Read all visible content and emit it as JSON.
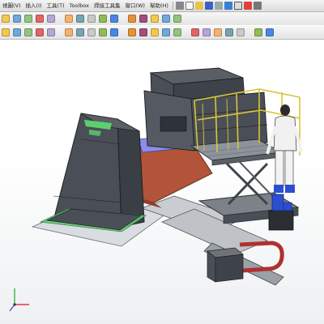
{
  "menubar": {
    "items": [
      {
        "id": "view",
        "label": "視圖(V)"
      },
      {
        "id": "insert",
        "label": "插入(I)"
      },
      {
        "id": "tools",
        "label": "工具(T)"
      },
      {
        "id": "toolbox",
        "label": "Toolbox"
      },
      {
        "id": "weld",
        "label": "焊接工具集"
      },
      {
        "id": "window",
        "label": "窗口(W)"
      },
      {
        "id": "help",
        "label": "幫助(H)"
      }
    ],
    "quick_icons": [
      "pin-icon",
      "new-doc-icon",
      "open-icon",
      "save-icon",
      "print-icon",
      "undo-icon",
      "select-icon",
      "rebuild-icon",
      "options-icon"
    ]
  },
  "toolbar1": {
    "icons": [
      "sketch-icon",
      "line-icon",
      "rectangle-icon",
      "circle-icon",
      "arc-icon",
      "spline-icon",
      "point-icon",
      "mirror-icon",
      "trim-icon",
      "convert-icon",
      "offset-icon",
      "pattern-icon",
      "move-icon",
      "dimension-icon",
      "relation-icon"
    ]
  },
  "toolbar2": {
    "icons": [
      "assembly-icon",
      "insert-component-icon",
      "mate-icon",
      "linear-pattern-icon",
      "smart-fastener-icon",
      "move-component-icon",
      "show-hidden-icon",
      "assembly-features-icon",
      "reference-geometry-icon",
      "new-motion-icon",
      "bill-of-materials-icon",
      "exploded-view-icon",
      "interference-icon",
      "zoom-fit-icon",
      "zoom-area-icon",
      "section-view-icon",
      "view-orientation-icon",
      "display-style-icon",
      "hide-show-icon",
      "appearance-icon",
      "scene-icon",
      "view-settings-icon"
    ]
  },
  "viewport": {
    "model": "welding-positioner-assembly"
  },
  "colors": {
    "frame": "#4a4f57",
    "green": "#5bd16e",
    "copper": "#b1543a",
    "railing": "#d8c536",
    "blue": "#2a4fd0"
  }
}
